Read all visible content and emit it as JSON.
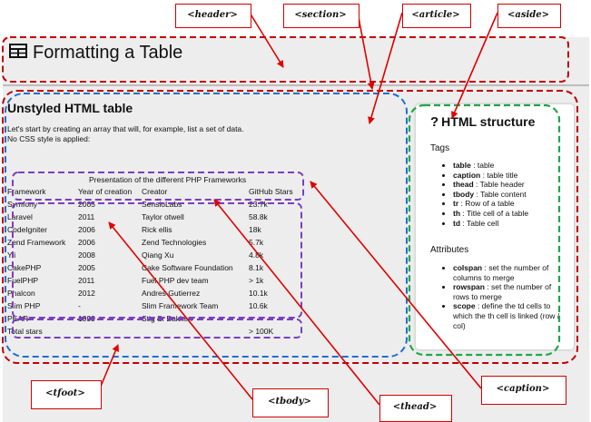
{
  "page": {
    "title": "Formatting a Table"
  },
  "section": {
    "title": "Unstyled HTML table",
    "intro_line1": "Let's start by creating an array that will, for example, list a set of data.",
    "intro_line2": "No CSS style is applied:"
  },
  "table": {
    "caption": "Presentation of the different PHP Frameworks",
    "headers": [
      "Framework",
      "Year of creation",
      "Creator",
      "GitHub Stars"
    ],
    "rows": [
      [
        "Symfony",
        "2005",
        "SensioLabs",
        "23.7k"
      ],
      [
        "Laravel",
        "2011",
        "Taylor otwell",
        "58.8k"
      ],
      [
        "CodeIgniter",
        "2006",
        "Rick ellis",
        "18k"
      ],
      [
        "Zend Framework",
        "2006",
        "Zend Technologies",
        "5.7k"
      ],
      [
        "Yii",
        "2008",
        "Qiang Xu",
        "4.8k"
      ],
      [
        "CakePHP",
        "2005",
        "Cake Software Foundation",
        "8.1k"
      ],
      [
        "FuelPHP",
        "2011",
        "Fuel PHP dev team",
        "> 1k"
      ],
      [
        "Phalcon",
        "2012",
        "Andres Gutierrez",
        "10.1k"
      ],
      [
        "Slim PHP",
        "-",
        "Slim Framework Team",
        "10.6k"
      ],
      [
        "PEAR",
        "1999",
        "Stig S. Bakken",
        "-"
      ]
    ],
    "footer": [
      "Total stars",
      "",
      "",
      "> 100K"
    ]
  },
  "aside": {
    "title": "HTML structure",
    "tags_heading": "Tags",
    "tags": [
      {
        "name": "table",
        "desc": " : table"
      },
      {
        "name": "caption",
        "desc": " : table title"
      },
      {
        "name": "thead",
        "desc": " : Table header"
      },
      {
        "name": "tbody",
        "desc": " : Table content"
      },
      {
        "name": "tr",
        "desc": " : Row of a table"
      },
      {
        "name": "th",
        "desc": " : Title cell of a table"
      },
      {
        "name": "td",
        "desc": " : Table cell"
      }
    ],
    "attributes_heading": "Attributes",
    "attributes": [
      {
        "name": "colspan",
        "desc": " : set the number of columns to merge"
      },
      {
        "name": "rowspan",
        "desc": " : set the number of rows to merge"
      },
      {
        "name": "scope",
        "desc": " : define the td cells to which the th cell is linked (row / col)"
      }
    ]
  },
  "annotations": {
    "header": "<header>",
    "section": "<section>",
    "article": "<article>",
    "aside": "<aside>",
    "tfoot": "<tfoot>",
    "tbody": "<tbody>",
    "thead": "<thead>",
    "caption": "<caption>"
  },
  "colors": {
    "header_region": "#c00000",
    "section_region": "#1f6fd0",
    "aside_region": "#1fa64a",
    "table_parts": "#7b3fbf",
    "arrows": "#e00000"
  }
}
